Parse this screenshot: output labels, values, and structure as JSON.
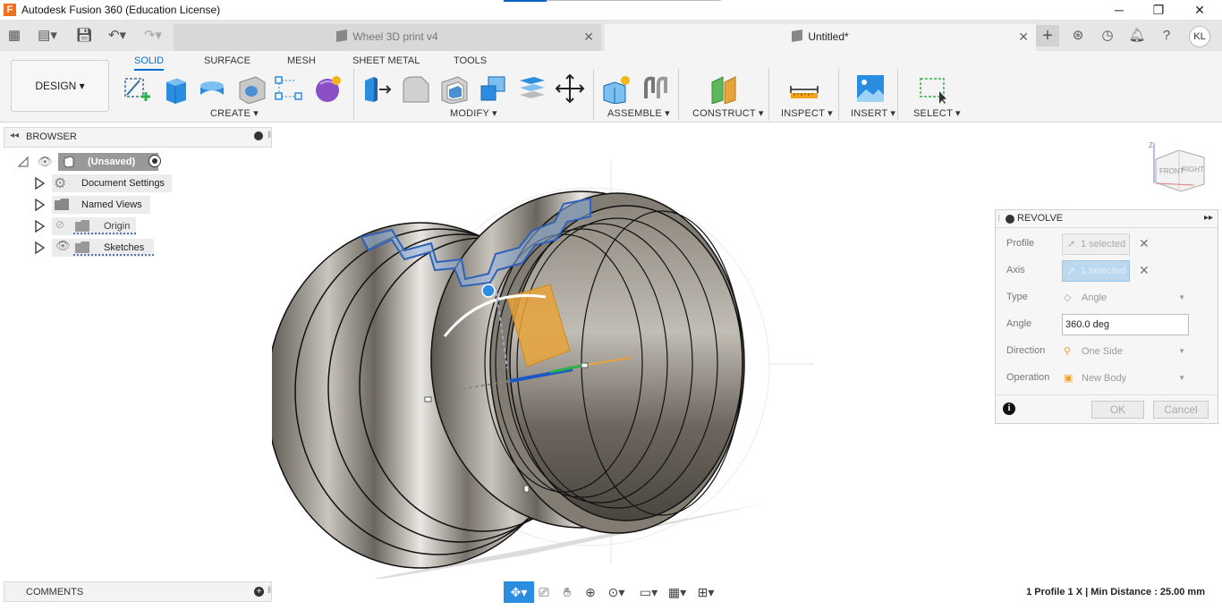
{
  "window": {
    "title": "Autodesk Fusion 360 (Education License)",
    "minimize": "─",
    "maximize": "❐",
    "close": "✕"
  },
  "tabs": [
    {
      "label": "Wheel 3D print v4",
      "active": false
    },
    {
      "label": "Untitled*",
      "active": true
    }
  ],
  "user": {
    "initials": "KL"
  },
  "workspace": {
    "label": "DESIGN ▾"
  },
  "ribbon_tabs": [
    "SOLID",
    "SURFACE",
    "MESH",
    "SHEET METAL",
    "TOOLS"
  ],
  "ribbon_groups": {
    "create": "CREATE ▾",
    "modify": "MODIFY ▾",
    "assemble": "ASSEMBLE ▾",
    "construct": "CONSTRUCT ▾",
    "inspect": "INSPECT ▾",
    "insert": "INSERT ▾",
    "select": "SELECT ▾"
  },
  "browser": {
    "title": "BROWSER",
    "root": "(Unsaved)",
    "items": [
      "Document Settings",
      "Named Views",
      "Origin",
      "Sketches"
    ]
  },
  "revolve": {
    "title": "REVOLVE",
    "profile_label": "Profile",
    "profile_value": "1 selected",
    "axis_label": "Axis",
    "axis_value": "1 selected",
    "type_label": "Type",
    "type_value": "Angle",
    "angle_label": "Angle",
    "angle_value": "360.0 deg",
    "direction_label": "Direction",
    "direction_value": "One Side",
    "operation_label": "Operation",
    "operation_value": "New Body",
    "ok": "OK",
    "cancel": "Cancel"
  },
  "viewcube": {
    "front": "FRONT",
    "right": "RIGHT"
  },
  "comments": {
    "title": "COMMENTS"
  },
  "status": "1 Profile 1 X | Min Distance : 25.00 mm",
  "colors": {
    "accent": "#0a6fd1",
    "selection_blue": "#bcd8ee",
    "preview_orange": "#e8a33a",
    "body_gray": "#6f6a62"
  }
}
